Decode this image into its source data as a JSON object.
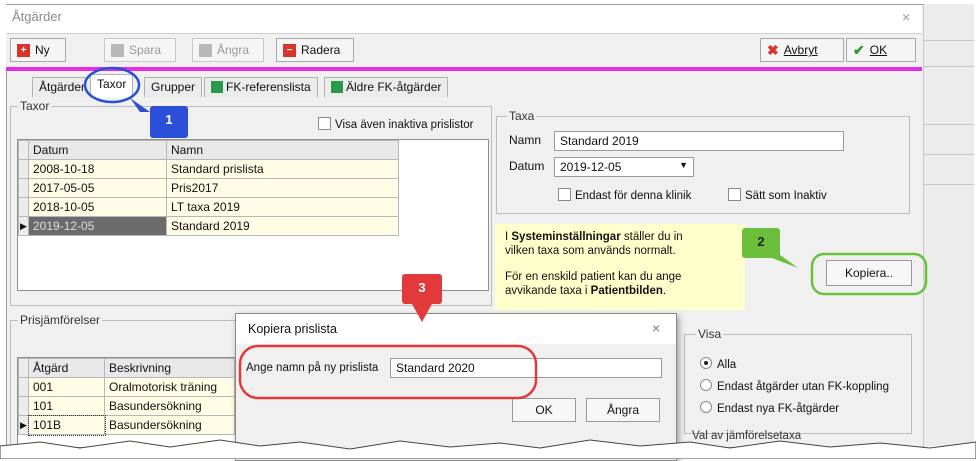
{
  "window": {
    "title": "Åtgärder",
    "close": "×"
  },
  "toolbar": {
    "new": "Ny",
    "save": "Spara",
    "undo": "Ångra",
    "delete": "Radera",
    "cancel": "Avbryt",
    "ok": "OK"
  },
  "tabs": [
    "Åtgärder",
    "Taxor",
    "Grupper",
    "FK-referenslista",
    "Äldre FK-åtgärder"
  ],
  "taxor": {
    "group_label": "Taxor",
    "show_inactive": "Visa även inaktiva prislistor",
    "columns": [
      "Datum",
      "Namn"
    ],
    "rows": [
      [
        "2008-10-18",
        "Standard prislista"
      ],
      [
        "2017-05-05",
        "Pris2017"
      ],
      [
        "2018-10-05",
        "LT taxa 2019"
      ],
      [
        "2019-12-05",
        "Standard 2019"
      ]
    ]
  },
  "taxa": {
    "group_label": "Taxa",
    "name_label": "Namn",
    "name_value": "Standard 2019",
    "date_label": "Datum",
    "date_value": "2019-12-05",
    "clinic_only": "Endast för denna klinik",
    "set_inactive": "Sätt som Inaktiv"
  },
  "info": {
    "line1_pre": "I ",
    "line1_bold": "Systeminställningar",
    "line1_post": " ställer du in",
    "line2": "vilken taxa som används normalt.",
    "line3": "För en enskild patient kan du ange",
    "line4_pre": "avvikande taxa i ",
    "line4_bold": "Patientbilden",
    "line4_post": "."
  },
  "copy_button": "Kopiera..",
  "callouts": [
    "1",
    "2",
    "3"
  ],
  "prisjamforelser": {
    "group_label": "Prisjämförelser",
    "columns": [
      "Åtgärd",
      "Beskrivning"
    ],
    "rows": [
      [
        "001",
        "Oralmotorisk träning"
      ],
      [
        "101",
        "Basundersökning"
      ],
      [
        "101B",
        "Basundersökning"
      ]
    ]
  },
  "visa": {
    "group_label": "Visa",
    "options": [
      "Alla",
      "Endast åtgärder utan FK-koppling",
      "Endast nya FK-åtgärder"
    ],
    "selected": 0,
    "footer": "Val av jämförelsetaxa"
  },
  "dialog": {
    "title": "Kopiera prislista",
    "close": "×",
    "prompt": "Ange namn på ny prislista",
    "value": "Standard 2020",
    "ok": "OK",
    "cancel": "Ångra"
  },
  "colors": {
    "accent_magenta": "#e62ee6",
    "callout_blue": "#2b4fd6",
    "callout_green": "#6cbf3a",
    "callout_red": "#e23a3a"
  }
}
